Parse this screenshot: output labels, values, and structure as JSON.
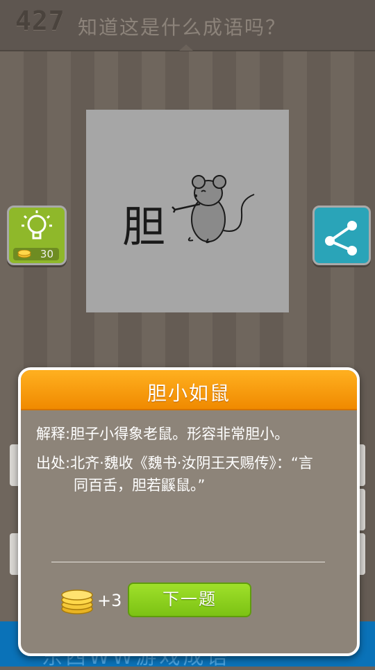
{
  "header": {
    "level": "427",
    "question": "知道这是什么成语吗？"
  },
  "puzzle": {
    "char": "胆",
    "picture": "mouse-pointing-drawing"
  },
  "hint": {
    "icon": "lightbulb-icon",
    "cost": "30"
  },
  "share": {
    "icon": "share-icon"
  },
  "bottom_banner": {
    "text": "东西WW游戏成语"
  },
  "modal": {
    "title": "胆小如鼠",
    "explanation": "解释:胆子小得象老鼠。形容非常胆小。",
    "source_line1": "出处:北齐·魏收《魏书·汝阴王天赐传》：“言",
    "source_line2": "同百舌，胆若鼷鼠。”",
    "reward": "+3",
    "next_label": "下一题"
  },
  "colors": {
    "header_bg": "#5e5650",
    "modal_head": "#f08a00",
    "next_button": "#8bd01e",
    "hint_button": "#8fb82a",
    "share_button": "#2aa4b8",
    "bottom_band": "#0a72b8"
  }
}
